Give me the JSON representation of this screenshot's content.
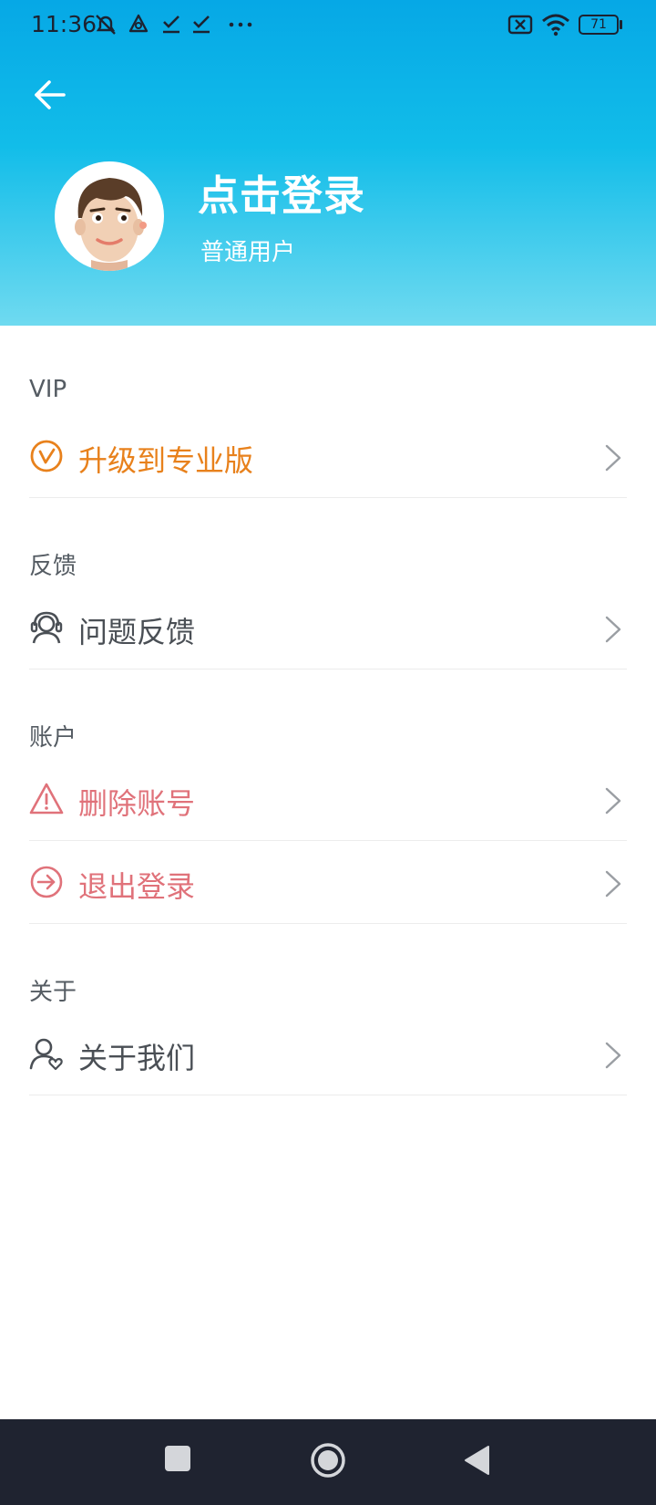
{
  "status_bar": {
    "time": "11:36",
    "battery": "71"
  },
  "header": {
    "back_icon": "arrow-left-icon",
    "title": "点击登录",
    "subtitle": "普通用户"
  },
  "sections": {
    "vip": {
      "title": "VIP",
      "items": [
        {
          "label": "升级到专业版",
          "icon": "vip-badge-icon",
          "color": "#e8811c"
        }
      ]
    },
    "feedback": {
      "title": "反馈",
      "items": [
        {
          "label": "问题反馈",
          "icon": "support-agent-icon",
          "color": "#4a4f55"
        }
      ]
    },
    "account": {
      "title": "账户",
      "items": [
        {
          "label": "删除账号",
          "icon": "warning-icon",
          "color": "#e0727a"
        },
        {
          "label": "退出登录",
          "icon": "logout-icon",
          "color": "#e0727a"
        }
      ]
    },
    "about": {
      "title": "关于",
      "items": [
        {
          "label": "关于我们",
          "icon": "user-heart-icon",
          "color": "#4a4f55"
        }
      ]
    }
  },
  "colors": {
    "header_top": "#06a8e6",
    "header_bottom": "#6fdaf0",
    "vip_orange": "#e8811c",
    "danger_pink": "#e0727a",
    "nav_bar": "#1f2330"
  }
}
